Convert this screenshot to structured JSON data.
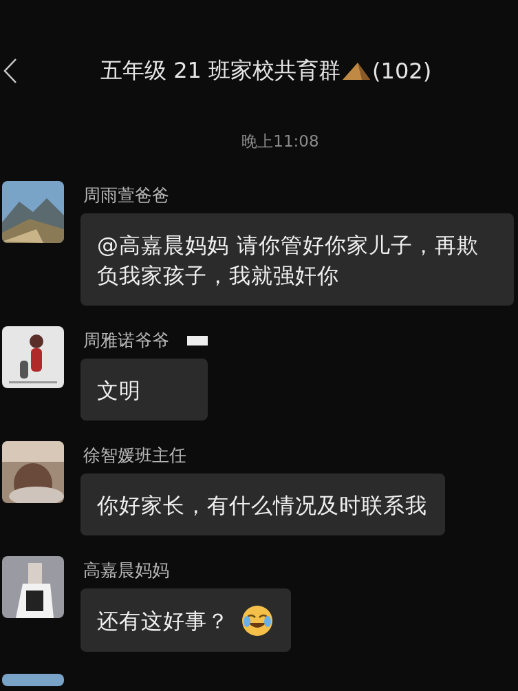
{
  "header": {
    "title": "五年级 21 班家校共育群",
    "member_count": "(102)"
  },
  "timestamp": "晚上11:08",
  "messages": [
    {
      "kind": "text",
      "sender": "周雨萱爸爸",
      "text": "@高嘉晨妈妈 请你管好你家儿子，再欺负我家孩子，我就强奸你"
    },
    {
      "kind": "text",
      "sender": "周雅诺爷爷",
      "text": "文明",
      "redacted": true
    },
    {
      "kind": "text",
      "sender": "徐智媛班主任",
      "text": "你好家长，有什么情况及时联系我"
    },
    {
      "kind": "text",
      "sender": "高嘉晨妈妈",
      "text": "还有这好事？",
      "has_emoji": true
    },
    {
      "kind": "cut_off"
    }
  ]
}
